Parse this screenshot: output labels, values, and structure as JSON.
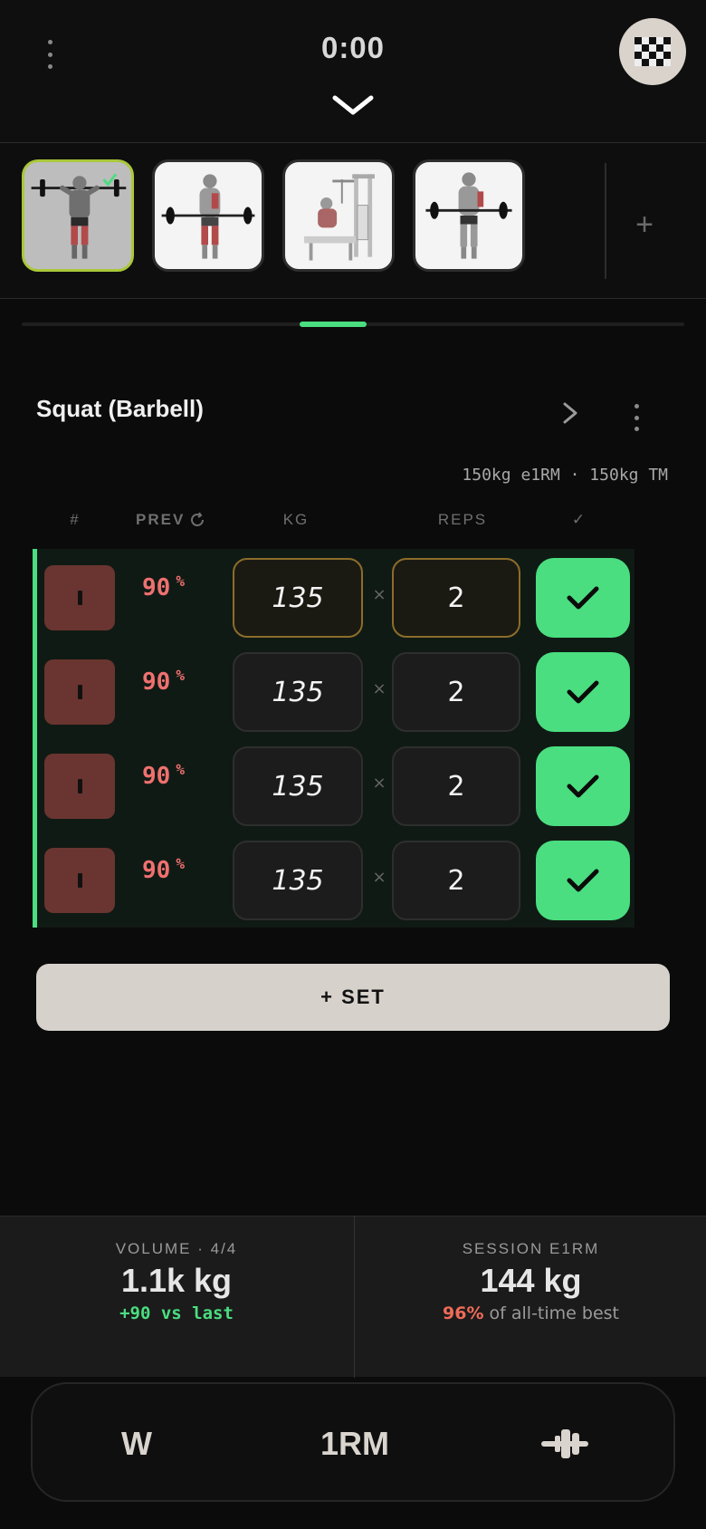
{
  "header": {
    "timer": "0:00",
    "menu_icon": "vertical-dots-icon",
    "collapse_icon": "chevron-down-icon",
    "avatar_icon": "checkered-flag-icon"
  },
  "thumbnails": {
    "items": [
      {
        "name": "overhead press exercise",
        "active": true,
        "completed": true
      },
      {
        "name": "barbell row exercise",
        "active": false
      },
      {
        "name": "cable row exercise",
        "active": false
      },
      {
        "name": "barbell curl exercise",
        "active": false
      }
    ],
    "add_label": "+"
  },
  "progress": {
    "fraction": 0.4,
    "start_fraction": 0.42,
    "end_fraction": 0.52
  },
  "exercise": {
    "title": "Squat (Barbell)",
    "summary": "150kg e1RM · 150kg TM"
  },
  "table_header": {
    "num": "#",
    "prev": "PREV",
    "kg": "KG",
    "reps": "REPS",
    "check": "✓"
  },
  "sets": [
    {
      "type": "I",
      "prev": "90",
      "prev_unit": "%",
      "kg": "135",
      "times": "×",
      "reps": "2",
      "done": true,
      "highlight": true
    },
    {
      "type": "I",
      "prev": "90",
      "prev_unit": "%",
      "kg": "135",
      "times": "×",
      "reps": "2",
      "done": true,
      "highlight": false
    },
    {
      "type": "I",
      "prev": "90",
      "prev_unit": "%",
      "kg": "135",
      "times": "×",
      "reps": "2",
      "done": true,
      "highlight": false
    },
    {
      "type": "I",
      "prev": "90",
      "prev_unit": "%",
      "kg": "135",
      "times": "×",
      "reps": "2",
      "done": true,
      "highlight": false
    }
  ],
  "add_set_label": "+ SET",
  "stats": {
    "volume": {
      "label": "VOLUME · 4/4",
      "value": "1.1k kg",
      "sub": "+90 vs last"
    },
    "e1rm": {
      "label": "SESSION E1RM",
      "value": "144 kg",
      "sub_highlight": "96%",
      "sub_rest": " of all-time best"
    }
  },
  "bottom_bar": {
    "warmup_label": "W",
    "one_rm_label": "1RM",
    "plate_icon": "barbell-plate-icon"
  },
  "colors": {
    "accent_green": "#4ade80",
    "warning_red": "#ef6b58",
    "set_type_bg": "#6a3530",
    "active_thumb_border": "#a9c83a"
  }
}
